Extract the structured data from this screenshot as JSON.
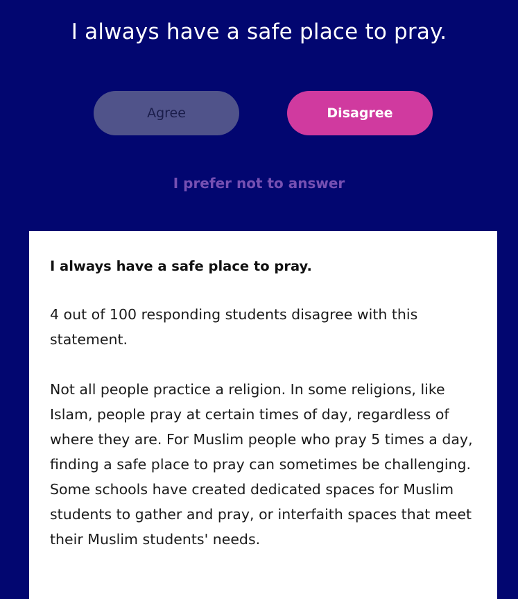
{
  "question": {
    "title": "I always have a safe place to pray."
  },
  "answers": {
    "agree_label": "Agree",
    "disagree_label": "Disagree",
    "prefer_not_label": "I prefer not to answer",
    "selected": "Disagree"
  },
  "result": {
    "heading": "I always have a safe place to pray.",
    "stat": "4 out of 100 responding students disagree with this statement.",
    "body": "Not all people practice a religion. In some religions, like Islam, people pray at certain times of day, regardless of where they are. For Muslim people who pray 5 times a day, finding a safe place to pray can sometimes be challenging. Some schools have created dedicated spaces for Muslim students to gather and pray, or interfaith spaces that meet their Muslim students' needs."
  },
  "colors": {
    "background": "#020670",
    "agree_button": "#50538a",
    "disagree_button": "#d03a9f",
    "prefer_link": "#7650b3",
    "card": "#ffffff"
  }
}
